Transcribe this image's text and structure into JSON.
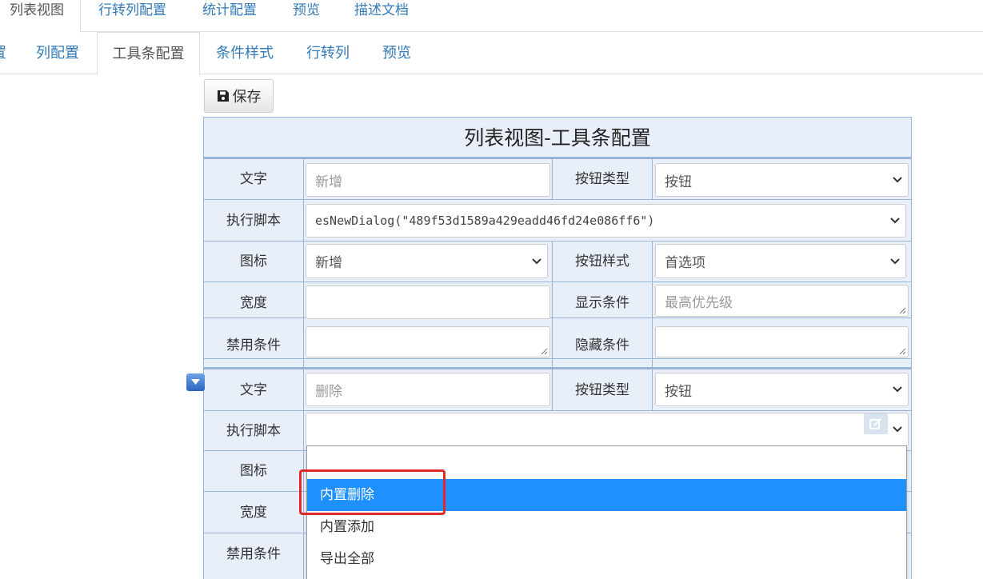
{
  "top_tabs": [
    "列表视图",
    "行转列配置",
    "统计配置",
    "预览",
    "描述文档"
  ],
  "sub_tabs": [
    "置",
    "列配置",
    "工具条配置",
    "条件样式",
    "行转列",
    "预览"
  ],
  "save_label": "保存",
  "panel_title": "列表视图-工具条配置",
  "labels": {
    "text": "文字",
    "button_type": "按钮类型",
    "script": "执行脚本",
    "icon": "图标",
    "button_style": "按钮样式",
    "width": "宽度",
    "display_condition": "显示条件",
    "disabled_condition": "禁用条件",
    "hidden_condition": "隐藏条件"
  },
  "item1": {
    "text_placeholder": "新增",
    "button_type": "按钮",
    "script": "esNewDialog(\"489f53d1589a429eadd46fd24e086ff6\")",
    "icon": "新增",
    "button_style": "首选项",
    "width": "",
    "display_condition_placeholder": "最高优先级",
    "disabled_condition": "",
    "hidden_condition": ""
  },
  "item2": {
    "text_placeholder": "删除",
    "button_type": "按钮",
    "script": ""
  },
  "script_dropdown": {
    "options": [
      "",
      "内置删除",
      "内置添加",
      "导出全部"
    ],
    "highlighted": "内置删除"
  },
  "colors": {
    "panel_bg": "#e9eff8",
    "panel_border": "#98b4d9",
    "link": "#337ab7",
    "selected_option": "#1e90ff",
    "annotation_box": "#e02a2a"
  }
}
